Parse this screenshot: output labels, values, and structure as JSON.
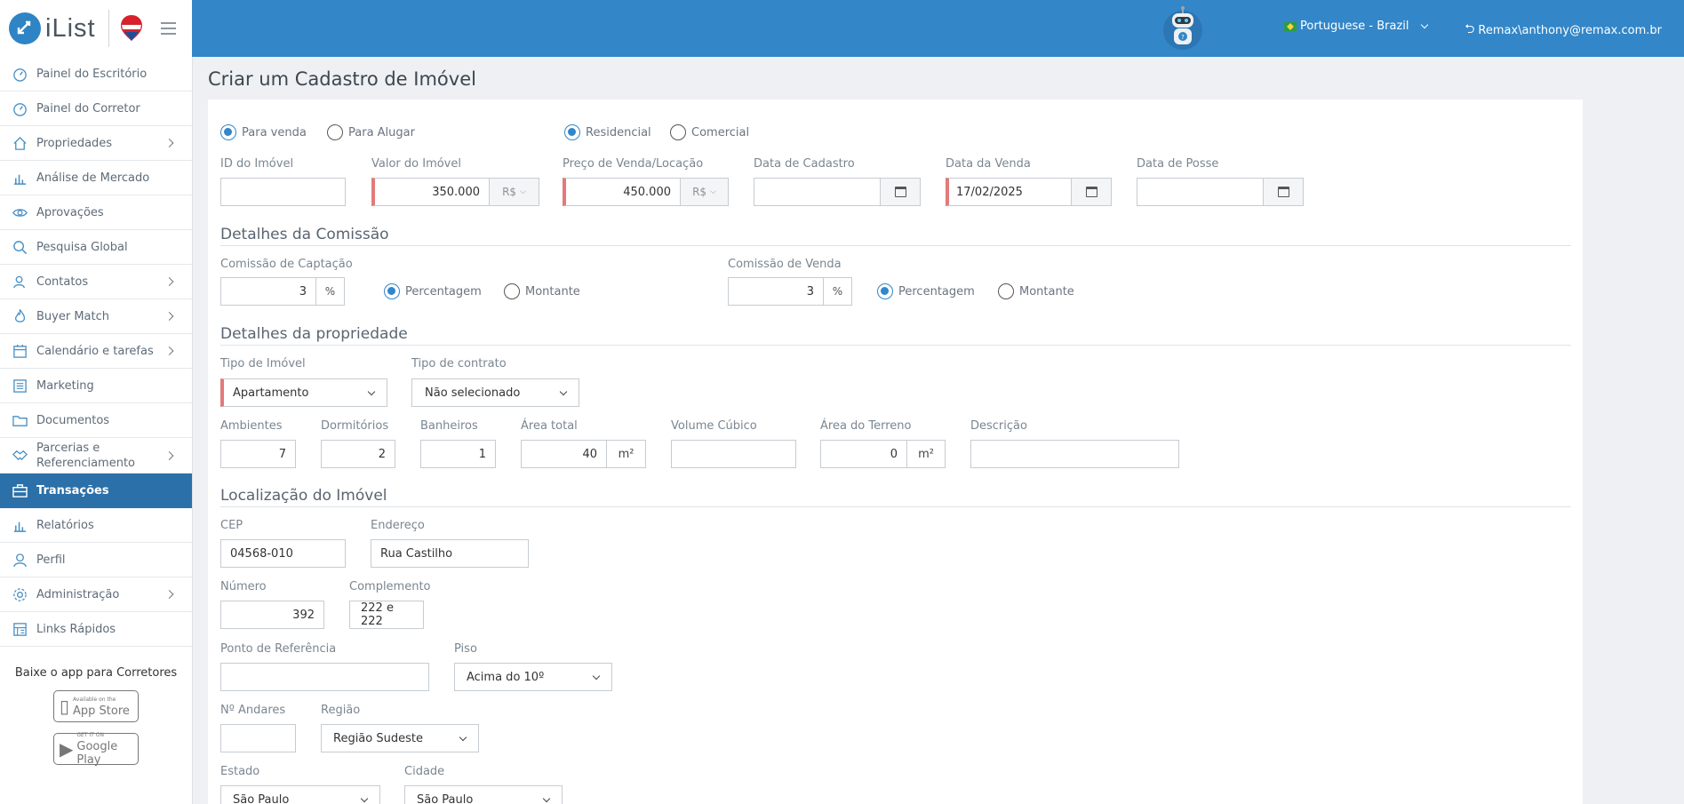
{
  "app": {
    "name": "iList"
  },
  "sidebar": {
    "items": [
      {
        "label": "Painel do Escritório",
        "icon": "dashboard-icon",
        "chevron": false
      },
      {
        "label": "Painel do Corretor",
        "icon": "dashboard-icon",
        "chevron": false
      },
      {
        "label": "Propriedades",
        "icon": "home-icon",
        "chevron": true
      },
      {
        "label": "Análise de Mercado",
        "icon": "bar-chart-icon",
        "chevron": false
      },
      {
        "label": "Aprovações",
        "icon": "eye-icon",
        "chevron": false
      },
      {
        "label": "Pesquisa Global",
        "icon": "search-icon",
        "chevron": false
      },
      {
        "label": "Contatos",
        "icon": "contacts-icon",
        "chevron": true
      },
      {
        "label": "Buyer Match",
        "icon": "flame-icon",
        "chevron": true
      },
      {
        "label": "Calendário e tarefas",
        "icon": "calendar-icon",
        "chevron": true
      },
      {
        "label": "Marketing",
        "icon": "newspaper-icon",
        "chevron": false
      },
      {
        "label": "Documentos",
        "icon": "folder-icon",
        "chevron": false
      },
      {
        "label": "Parcerias e Referenciamento",
        "icon": "handshake-icon",
        "chevron": true
      },
      {
        "label": "Transações",
        "icon": "briefcase-icon",
        "chevron": false,
        "active": true
      },
      {
        "label": "Relatórios",
        "icon": "bar-chart-icon",
        "chevron": false
      },
      {
        "label": "Perfil",
        "icon": "user-icon",
        "chevron": false
      },
      {
        "label": "Administração",
        "icon": "gear-icon",
        "chevron": true
      },
      {
        "label": "Links Rápidos",
        "icon": "links-icon",
        "chevron": false
      }
    ],
    "app_download_title": "Baixe o app para Corretores",
    "app_store": {
      "small": "Available on the",
      "big": "App Store"
    },
    "google_play": {
      "small": "GET IT ON",
      "big": "Google Play"
    }
  },
  "topbar": {
    "language": "Portuguese - Brazil",
    "user": "Remax\\anthony@remax.com.br"
  },
  "page": {
    "title": "Criar um Cadastro de Imóvel"
  },
  "form": {
    "listing_type": {
      "options": [
        "Para venda",
        "Para Alugar"
      ],
      "selected": "Para venda"
    },
    "property_class": {
      "options": [
        "Residencial",
        "Comercial"
      ],
      "selected": "Residencial"
    },
    "id_label": "ID do Imóvel",
    "id_value": "",
    "value_label": "Valor do Imóvel",
    "value_value": "350.000",
    "currency": "R$",
    "price_label": "Preço de Venda/Locação",
    "price_value": "450.000",
    "reg_date_label": "Data de Cadastro",
    "reg_date_value": "",
    "sale_date_label": "Data da Venda",
    "sale_date_value": "17/02/2025",
    "possession_label": "Data de Posse",
    "possession_value": "",
    "commission_section": "Detalhes da Comissão",
    "capture_label": "Comissão de Captação",
    "capture_value": "3",
    "sale_comm_label": "Comissão de Venda",
    "sale_comm_value": "3",
    "percent_symbol": "%",
    "commission_options": [
      "Percentagem",
      "Montante"
    ],
    "property_section": "Detalhes da propriedade",
    "type_label": "Tipo de Imóvel",
    "type_value": "Apartamento",
    "contract_label": "Tipo de contrato",
    "contract_value": "Não selecionado",
    "rooms_label": "Ambientes",
    "rooms_value": "7",
    "bedrooms_label": "Dormitórios",
    "bedrooms_value": "2",
    "bathrooms_label": "Banheiros",
    "bathrooms_value": "1",
    "area_label": "Área total",
    "area_value": "40",
    "area_unit": "m²",
    "volume_label": "Volume Cúbico",
    "volume_value": "",
    "land_label": "Área do Terreno",
    "land_value": "0",
    "description_label": "Descrição",
    "description_value": "",
    "location_section": "Localização do Imóvel",
    "cep_label": "CEP",
    "cep_value": "04568-010",
    "address_label": "Endereço",
    "address_value": "Rua Castilho",
    "number_label": "Número",
    "number_value": "392",
    "complement_label": "Complemento",
    "complement_value": "222 e 222",
    "reference_label": "Ponto de Referência",
    "reference_value": "",
    "floor_label": "Piso",
    "floor_value": "Acima do 10º",
    "floors_label": "Nº Andares",
    "floors_value": "",
    "region_label": "Região",
    "region_value": "Região Sudeste",
    "state_label": "Estado",
    "state_value": "São Paulo",
    "city_label": "Cidade",
    "city_value": "São Paulo"
  },
  "colors": {
    "primary": "#3386c8",
    "active_nav": "#2b70a8",
    "required": "#e37a7a"
  }
}
